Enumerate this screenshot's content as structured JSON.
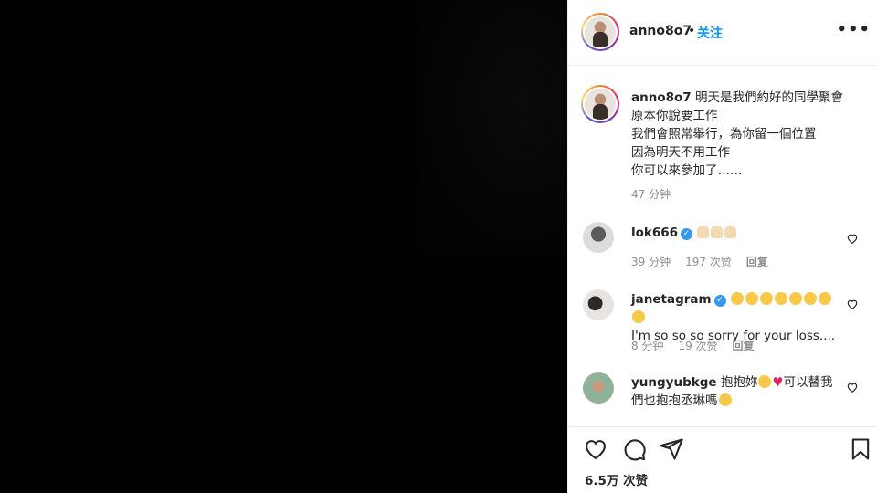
{
  "header": {
    "username": "anno8o7",
    "separator": "•",
    "follow_label": "关注",
    "more_label": "•••"
  },
  "caption": {
    "username": "anno8o7",
    "lines": [
      "明天是我們約好的同學聚會",
      "原本你說要工作",
      "我們會照常舉行，為你留一個位置",
      "因為明天不用工作",
      "你可以來參加了……"
    ],
    "time": "47 分钟"
  },
  "comments": [
    {
      "username": "lok666",
      "verified": true,
      "emoji": [
        "folded-hands",
        "folded-hands",
        "folded-hands"
      ],
      "text": "",
      "time": "39 分钟",
      "likes": "197 次赞",
      "reply": "回复"
    },
    {
      "username": "janetagram",
      "verified": true,
      "emoji": [
        "loudly-crying-face",
        "loudly-crying-face",
        "loudly-crying-face",
        "loudly-crying-face",
        "loudly-crying-face",
        "loudly-crying-face",
        "loudly-crying-face",
        "loudly-crying-face"
      ],
      "text": "I'm so so so sorry for your loss....",
      "time": "8 分钟",
      "likes": "19 次赞",
      "reply": "回复"
    },
    {
      "username": "yungyubkge",
      "verified": false,
      "text_part1": "抱抱妳",
      "text_part2": "可以替我",
      "text_line2": "們也抱抱丞琳嗎"
    }
  ],
  "actions": {
    "likes": "6.5万 次赞"
  },
  "colors": {
    "accent": "#0095f6",
    "muted": "#8e8e8e",
    "verified": "#3897f0"
  }
}
